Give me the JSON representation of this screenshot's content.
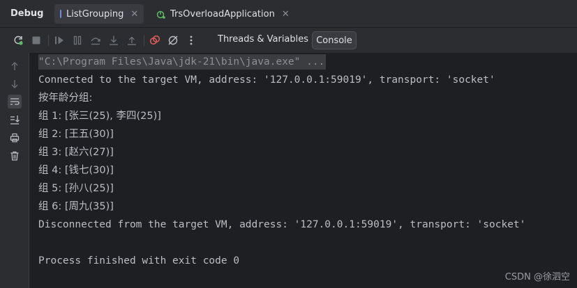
{
  "panel_title": "Debug",
  "tabs": [
    {
      "label": "ListGrouping",
      "icon": "java-class-icon",
      "active": true
    },
    {
      "label": "TrsOverloadApplication",
      "icon": "spring-boot-icon",
      "active": false
    }
  ],
  "toolbar": {
    "threads_label": "Threads & Variables",
    "console_label": "Console"
  },
  "console": {
    "lines": [
      "\"C:\\Program Files\\Java\\jdk-21\\bin\\java.exe\" ...",
      "Connected to the target VM, address: '127.0.0.1:59019', transport: 'socket'",
      "按年龄分组:",
      "组 1: [张三(25), 李四(25)]",
      "组 2: [王五(30)]",
      "组 3: [赵六(27)]",
      "组 4: [钱七(30)]",
      "组 5: [孙八(25)]",
      "组 6: [周九(35)]",
      "Disconnected from the target VM, address: '127.0.0.1:59019', transport: 'socket'",
      "",
      "Process finished with exit code 0"
    ]
  },
  "watermark": "CSDN @徐泗空",
  "colors": {
    "background": "#1e1f22",
    "panel": "#2b2d30",
    "text": "#bcbec4",
    "accent_red": "#db5c5c",
    "accent_green": "#5fb865"
  }
}
